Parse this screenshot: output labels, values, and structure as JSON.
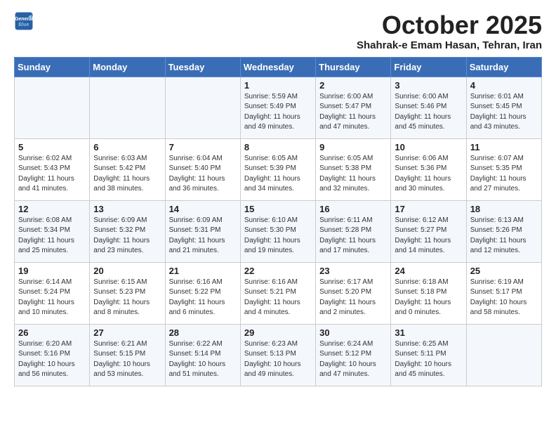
{
  "header": {
    "logo_line1": "General",
    "logo_line2": "Blue",
    "month": "October 2025",
    "location": "Shahrak-e Emam Hasan, Tehran, Iran"
  },
  "weekdays": [
    "Sunday",
    "Monday",
    "Tuesday",
    "Wednesday",
    "Thursday",
    "Friday",
    "Saturday"
  ],
  "weeks": [
    [
      {
        "day": "",
        "info": ""
      },
      {
        "day": "",
        "info": ""
      },
      {
        "day": "",
        "info": ""
      },
      {
        "day": "1",
        "info": "Sunrise: 5:59 AM\nSunset: 5:49 PM\nDaylight: 11 hours\nand 49 minutes."
      },
      {
        "day": "2",
        "info": "Sunrise: 6:00 AM\nSunset: 5:47 PM\nDaylight: 11 hours\nand 47 minutes."
      },
      {
        "day": "3",
        "info": "Sunrise: 6:00 AM\nSunset: 5:46 PM\nDaylight: 11 hours\nand 45 minutes."
      },
      {
        "day": "4",
        "info": "Sunrise: 6:01 AM\nSunset: 5:45 PM\nDaylight: 11 hours\nand 43 minutes."
      }
    ],
    [
      {
        "day": "5",
        "info": "Sunrise: 6:02 AM\nSunset: 5:43 PM\nDaylight: 11 hours\nand 41 minutes."
      },
      {
        "day": "6",
        "info": "Sunrise: 6:03 AM\nSunset: 5:42 PM\nDaylight: 11 hours\nand 38 minutes."
      },
      {
        "day": "7",
        "info": "Sunrise: 6:04 AM\nSunset: 5:40 PM\nDaylight: 11 hours\nand 36 minutes."
      },
      {
        "day": "8",
        "info": "Sunrise: 6:05 AM\nSunset: 5:39 PM\nDaylight: 11 hours\nand 34 minutes."
      },
      {
        "day": "9",
        "info": "Sunrise: 6:05 AM\nSunset: 5:38 PM\nDaylight: 11 hours\nand 32 minutes."
      },
      {
        "day": "10",
        "info": "Sunrise: 6:06 AM\nSunset: 5:36 PM\nDaylight: 11 hours\nand 30 minutes."
      },
      {
        "day": "11",
        "info": "Sunrise: 6:07 AM\nSunset: 5:35 PM\nDaylight: 11 hours\nand 27 minutes."
      }
    ],
    [
      {
        "day": "12",
        "info": "Sunrise: 6:08 AM\nSunset: 5:34 PM\nDaylight: 11 hours\nand 25 minutes."
      },
      {
        "day": "13",
        "info": "Sunrise: 6:09 AM\nSunset: 5:32 PM\nDaylight: 11 hours\nand 23 minutes."
      },
      {
        "day": "14",
        "info": "Sunrise: 6:09 AM\nSunset: 5:31 PM\nDaylight: 11 hours\nand 21 minutes."
      },
      {
        "day": "15",
        "info": "Sunrise: 6:10 AM\nSunset: 5:30 PM\nDaylight: 11 hours\nand 19 minutes."
      },
      {
        "day": "16",
        "info": "Sunrise: 6:11 AM\nSunset: 5:28 PM\nDaylight: 11 hours\nand 17 minutes."
      },
      {
        "day": "17",
        "info": "Sunrise: 6:12 AM\nSunset: 5:27 PM\nDaylight: 11 hours\nand 14 minutes."
      },
      {
        "day": "18",
        "info": "Sunrise: 6:13 AM\nSunset: 5:26 PM\nDaylight: 11 hours\nand 12 minutes."
      }
    ],
    [
      {
        "day": "19",
        "info": "Sunrise: 6:14 AM\nSunset: 5:24 PM\nDaylight: 11 hours\nand 10 minutes."
      },
      {
        "day": "20",
        "info": "Sunrise: 6:15 AM\nSunset: 5:23 PM\nDaylight: 11 hours\nand 8 minutes."
      },
      {
        "day": "21",
        "info": "Sunrise: 6:16 AM\nSunset: 5:22 PM\nDaylight: 11 hours\nand 6 minutes."
      },
      {
        "day": "22",
        "info": "Sunrise: 6:16 AM\nSunset: 5:21 PM\nDaylight: 11 hours\nand 4 minutes."
      },
      {
        "day": "23",
        "info": "Sunrise: 6:17 AM\nSunset: 5:20 PM\nDaylight: 11 hours\nand 2 minutes."
      },
      {
        "day": "24",
        "info": "Sunrise: 6:18 AM\nSunset: 5:18 PM\nDaylight: 11 hours\nand 0 minutes."
      },
      {
        "day": "25",
        "info": "Sunrise: 6:19 AM\nSunset: 5:17 PM\nDaylight: 10 hours\nand 58 minutes."
      }
    ],
    [
      {
        "day": "26",
        "info": "Sunrise: 6:20 AM\nSunset: 5:16 PM\nDaylight: 10 hours\nand 56 minutes."
      },
      {
        "day": "27",
        "info": "Sunrise: 6:21 AM\nSunset: 5:15 PM\nDaylight: 10 hours\nand 53 minutes."
      },
      {
        "day": "28",
        "info": "Sunrise: 6:22 AM\nSunset: 5:14 PM\nDaylight: 10 hours\nand 51 minutes."
      },
      {
        "day": "29",
        "info": "Sunrise: 6:23 AM\nSunset: 5:13 PM\nDaylight: 10 hours\nand 49 minutes."
      },
      {
        "day": "30",
        "info": "Sunrise: 6:24 AM\nSunset: 5:12 PM\nDaylight: 10 hours\nand 47 minutes."
      },
      {
        "day": "31",
        "info": "Sunrise: 6:25 AM\nSunset: 5:11 PM\nDaylight: 10 hours\nand 45 minutes."
      },
      {
        "day": "",
        "info": ""
      }
    ]
  ]
}
